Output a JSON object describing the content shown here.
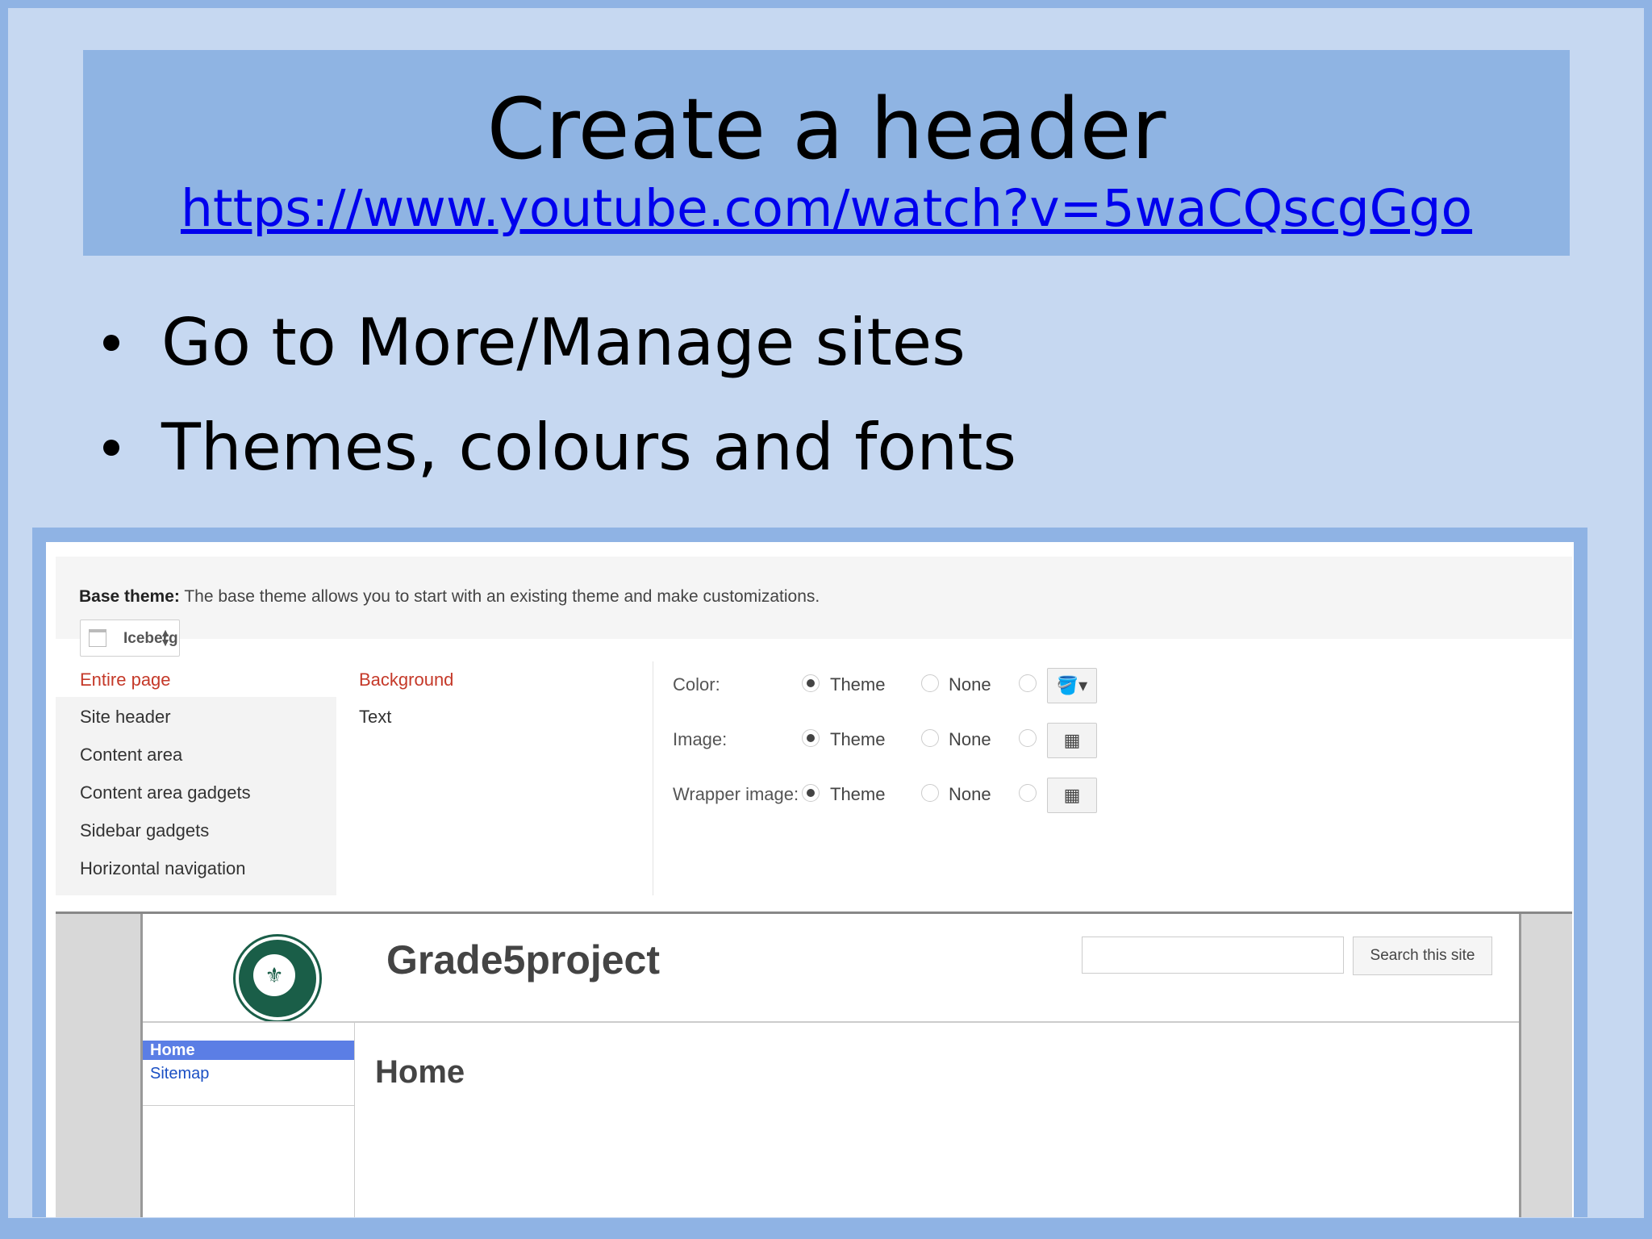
{
  "slide": {
    "title": "Create a header",
    "link": "https://www.youtube.com/watch?v=5waCQscgGgo",
    "bullets": [
      "Go to More/Manage sites",
      "Themes, colours and fonts"
    ]
  },
  "screenshot": {
    "base_theme_label": "Base theme:",
    "base_theme_desc": " The base theme allows you to start with an existing theme and make customizations.",
    "theme_select": "Iceberg",
    "sections": [
      "Entire page",
      "Site header",
      "Content area",
      "Content area gadgets",
      "Sidebar gadgets",
      "Horizontal navigation"
    ],
    "subsections": [
      "Background",
      "Text"
    ],
    "options": [
      {
        "label": "Color:",
        "theme": "Theme",
        "none": "None",
        "icon": "paint-bucket-icon"
      },
      {
        "label": "Image:",
        "theme": "Theme",
        "none": "None",
        "icon": "image-icon"
      },
      {
        "label": "Wrapper image:",
        "theme": "Theme",
        "none": "None",
        "icon": "image-icon"
      }
    ],
    "preview": {
      "site_title": "Grade5project",
      "search_button": "Search this site",
      "nav": [
        "Home",
        "Sitemap"
      ],
      "page_heading": "Home"
    }
  },
  "colors": {
    "background": "#c6d8f1",
    "title_box": "#8fb4e3",
    "link": "#0000ee",
    "active_red": "#c53929"
  }
}
